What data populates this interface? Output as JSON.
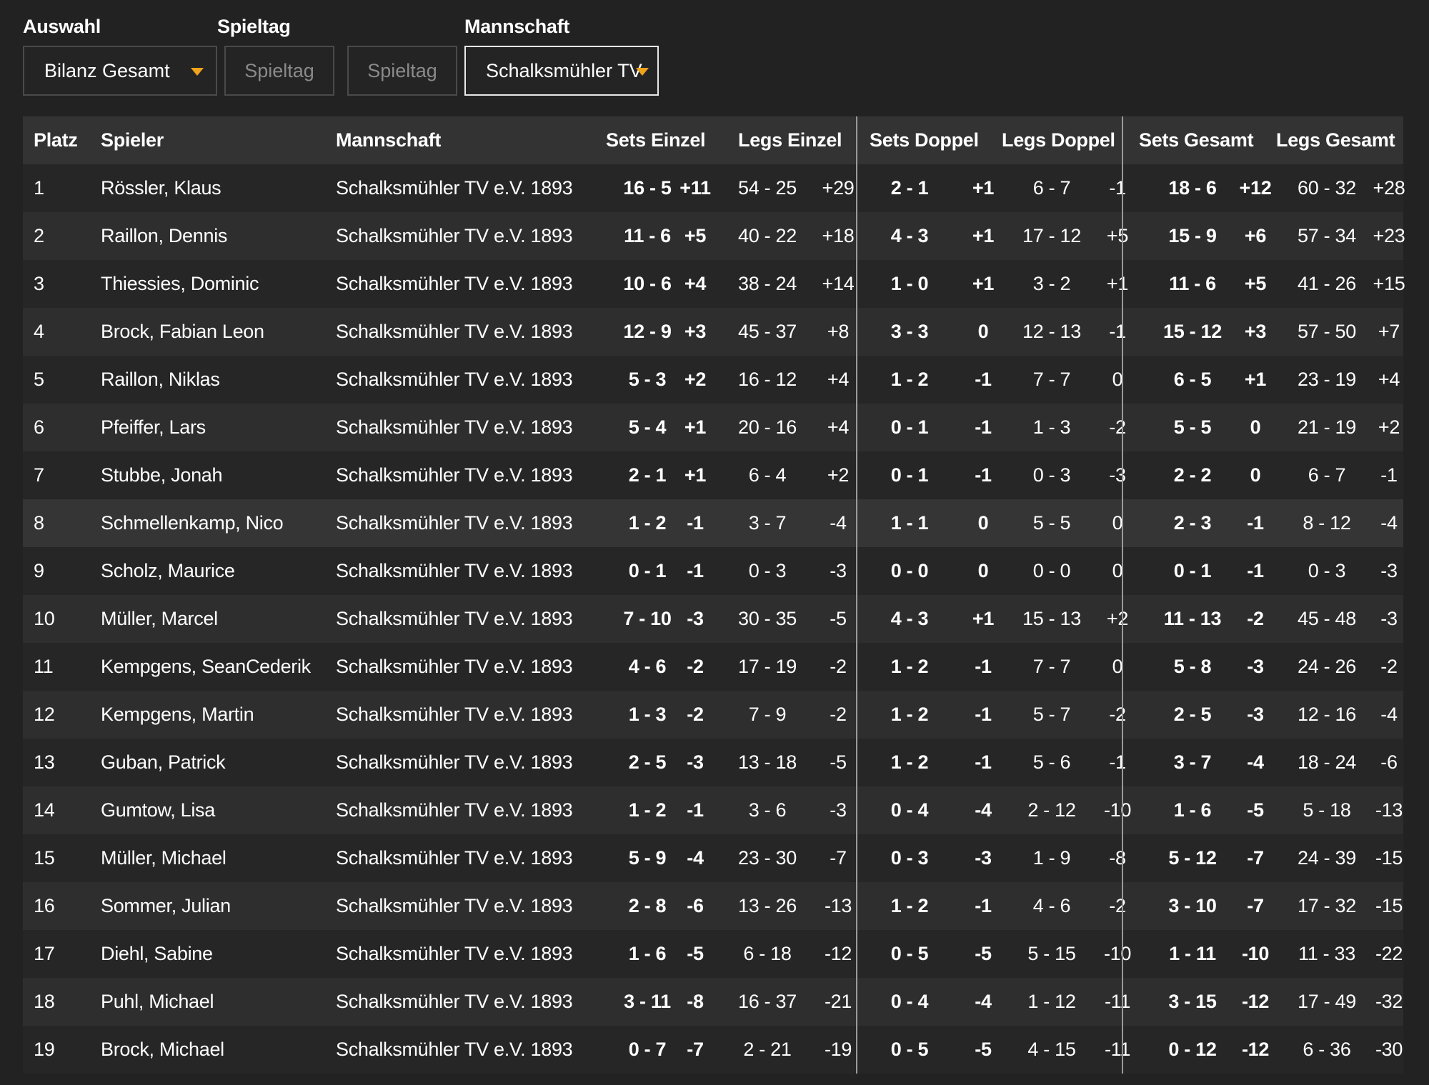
{
  "filters": {
    "selection_label": "Auswahl",
    "selection_value": "Bilanz Gesamt",
    "matchday_label": "Spieltag",
    "matchday_from_placeholder": "Spieltag",
    "matchday_to_placeholder": "Spieltag",
    "team_label": "Mannschaft",
    "team_value": "Schalksmühler TV",
    "caret_color": "#f0a41b"
  },
  "table": {
    "headers": {
      "platz": "Platz",
      "spieler": "Spieler",
      "mannschaft": "Mannschaft",
      "sets_einzel": "Sets Einzel",
      "legs_einzel": "Legs Einzel",
      "sets_doppel": "Sets Doppel",
      "legs_doppel": "Legs Doppel",
      "sets_gesamt": "Sets Gesamt",
      "legs_gesamt": "Legs Gesamt"
    },
    "rows": [
      {
        "platz": "1",
        "spieler": "Rössler, Klaus",
        "mannschaft": "Schalksmühler TV e.V. 1893",
        "se": "16 - 5",
        "sed": "+11",
        "le": "54 - 25",
        "led": "+29",
        "sd": "2 - 1",
        "sdd": "+1",
        "ld": "6 - 7",
        "ldd": "-1",
        "sg": "18 - 6",
        "sgd": "+12",
        "lg": "60 - 32",
        "lgd": "+28"
      },
      {
        "platz": "2",
        "spieler": "Raillon, Dennis",
        "mannschaft": "Schalksmühler TV e.V. 1893",
        "se": "11 - 6",
        "sed": "+5",
        "le": "40 - 22",
        "led": "+18",
        "sd": "4 - 3",
        "sdd": "+1",
        "ld": "17 - 12",
        "ldd": "+5",
        "sg": "15 - 9",
        "sgd": "+6",
        "lg": "57 - 34",
        "lgd": "+23"
      },
      {
        "platz": "3",
        "spieler": "Thiessies, Dominic",
        "mannschaft": "Schalksmühler TV e.V. 1893",
        "se": "10 - 6",
        "sed": "+4",
        "le": "38 - 24",
        "led": "+14",
        "sd": "1 - 0",
        "sdd": "+1",
        "ld": "3 - 2",
        "ldd": "+1",
        "sg": "11 - 6",
        "sgd": "+5",
        "lg": "41 - 26",
        "lgd": "+15"
      },
      {
        "platz": "4",
        "spieler": "Brock, Fabian Leon",
        "mannschaft": "Schalksmühler TV e.V. 1893",
        "se": "12 - 9",
        "sed": "+3",
        "le": "45 - 37",
        "led": "+8",
        "sd": "3 - 3",
        "sdd": "0",
        "ld": "12 - 13",
        "ldd": "-1",
        "sg": "15 - 12",
        "sgd": "+3",
        "lg": "57 - 50",
        "lgd": "+7"
      },
      {
        "platz": "5",
        "spieler": "Raillon, Niklas",
        "mannschaft": "Schalksmühler TV e.V. 1893",
        "se": "5 - 3",
        "sed": "+2",
        "le": "16 - 12",
        "led": "+4",
        "sd": "1 - 2",
        "sdd": "-1",
        "ld": "7 - 7",
        "ldd": "0",
        "sg": "6 - 5",
        "sgd": "+1",
        "lg": "23 - 19",
        "lgd": "+4"
      },
      {
        "platz": "6",
        "spieler": "Pfeiffer, Lars",
        "mannschaft": "Schalksmühler TV e.V. 1893",
        "se": "5 - 4",
        "sed": "+1",
        "le": "20 - 16",
        "led": "+4",
        "sd": "0 - 1",
        "sdd": "-1",
        "ld": "1 - 3",
        "ldd": "-2",
        "sg": "5 - 5",
        "sgd": "0",
        "lg": "21 - 19",
        "lgd": "+2"
      },
      {
        "platz": "7",
        "spieler": "Stubbe, Jonah",
        "mannschaft": "Schalksmühler TV e.V. 1893",
        "se": "2 - 1",
        "sed": "+1",
        "le": "6 - 4",
        "led": "+2",
        "sd": "0 - 1",
        "sdd": "-1",
        "ld": "0 - 3",
        "ldd": "-3",
        "sg": "2 - 2",
        "sgd": "0",
        "lg": "6 - 7",
        "lgd": "-1"
      },
      {
        "platz": "8",
        "spieler": "Schmellenkamp, Nico",
        "mannschaft": "Schalksmühler TV e.V. 1893",
        "se": "1 - 2",
        "sed": "-1",
        "le": "3 - 7",
        "led": "-4",
        "sd": "1 - 1",
        "sdd": "0",
        "ld": "5 - 5",
        "ldd": "0",
        "sg": "2 - 3",
        "sgd": "-1",
        "lg": "8 - 12",
        "lgd": "-4"
      },
      {
        "platz": "9",
        "spieler": "Scholz, Maurice",
        "mannschaft": "Schalksmühler TV e.V. 1893",
        "se": "0 - 1",
        "sed": "-1",
        "le": "0 - 3",
        "led": "-3",
        "sd": "0 - 0",
        "sdd": "0",
        "ld": "0 - 0",
        "ldd": "0",
        "sg": "0 - 1",
        "sgd": "-1",
        "lg": "0 - 3",
        "lgd": "-3"
      },
      {
        "platz": "10",
        "spieler": "Müller, Marcel",
        "mannschaft": "Schalksmühler TV e.V. 1893",
        "se": "7 - 10",
        "sed": "-3",
        "le": "30 - 35",
        "led": "-5",
        "sd": "4 - 3",
        "sdd": "+1",
        "ld": "15 - 13",
        "ldd": "+2",
        "sg": "11 - 13",
        "sgd": "-2",
        "lg": "45 - 48",
        "lgd": "-3"
      },
      {
        "platz": "11",
        "spieler": "Kempgens, SeanCederik",
        "mannschaft": "Schalksmühler TV e.V. 1893",
        "se": "4 - 6",
        "sed": "-2",
        "le": "17 - 19",
        "led": "-2",
        "sd": "1 - 2",
        "sdd": "-1",
        "ld": "7 - 7",
        "ldd": "0",
        "sg": "5 - 8",
        "sgd": "-3",
        "lg": "24 - 26",
        "lgd": "-2"
      },
      {
        "platz": "12",
        "spieler": "Kempgens, Martin",
        "mannschaft": "Schalksmühler TV e.V. 1893",
        "se": "1 - 3",
        "sed": "-2",
        "le": "7 - 9",
        "led": "-2",
        "sd": "1 - 2",
        "sdd": "-1",
        "ld": "5 - 7",
        "ldd": "-2",
        "sg": "2 - 5",
        "sgd": "-3",
        "lg": "12 - 16",
        "lgd": "-4"
      },
      {
        "platz": "13",
        "spieler": "Guban, Patrick",
        "mannschaft": "Schalksmühler TV e.V. 1893",
        "se": "2 - 5",
        "sed": "-3",
        "le": "13 - 18",
        "led": "-5",
        "sd": "1 - 2",
        "sdd": "-1",
        "ld": "5 - 6",
        "ldd": "-1",
        "sg": "3 - 7",
        "sgd": "-4",
        "lg": "18 - 24",
        "lgd": "-6"
      },
      {
        "platz": "14",
        "spieler": "Gumtow, Lisa",
        "mannschaft": "Schalksmühler TV e.V. 1893",
        "se": "1 - 2",
        "sed": "-1",
        "le": "3 - 6",
        "led": "-3",
        "sd": "0 - 4",
        "sdd": "-4",
        "ld": "2 - 12",
        "ldd": "-10",
        "sg": "1 - 6",
        "sgd": "-5",
        "lg": "5 - 18",
        "lgd": "-13"
      },
      {
        "platz": "15",
        "spieler": "Müller, Michael",
        "mannschaft": "Schalksmühler TV e.V. 1893",
        "se": "5 - 9",
        "sed": "-4",
        "le": "23 - 30",
        "led": "-7",
        "sd": "0 - 3",
        "sdd": "-3",
        "ld": "1 - 9",
        "ldd": "-8",
        "sg": "5 - 12",
        "sgd": "-7",
        "lg": "24 - 39",
        "lgd": "-15"
      },
      {
        "platz": "16",
        "spieler": "Sommer, Julian",
        "mannschaft": "Schalksmühler TV e.V. 1893",
        "se": "2 - 8",
        "sed": "-6",
        "le": "13 - 26",
        "led": "-13",
        "sd": "1 - 2",
        "sdd": "-1",
        "ld": "4 - 6",
        "ldd": "-2",
        "sg": "3 - 10",
        "sgd": "-7",
        "lg": "17 - 32",
        "lgd": "-15"
      },
      {
        "platz": "17",
        "spieler": "Diehl, Sabine",
        "mannschaft": "Schalksmühler TV e.V. 1893",
        "se": "1 - 6",
        "sed": "-5",
        "le": "6 - 18",
        "led": "-12",
        "sd": "0 - 5",
        "sdd": "-5",
        "ld": "5 - 15",
        "ldd": "-10",
        "sg": "1 - 11",
        "sgd": "-10",
        "lg": "11 - 33",
        "lgd": "-22"
      },
      {
        "platz": "18",
        "spieler": "Puhl, Michael",
        "mannschaft": "Schalksmühler TV e.V. 1893",
        "se": "3 - 11",
        "sed": "-8",
        "le": "16 - 37",
        "led": "-21",
        "sd": "0 - 4",
        "sdd": "-4",
        "ld": "1 - 12",
        "ldd": "-11",
        "sg": "3 - 15",
        "sgd": "-12",
        "lg": "17 - 49",
        "lgd": "-32"
      },
      {
        "platz": "19",
        "spieler": "Brock, Michael",
        "mannschaft": "Schalksmühler TV e.V. 1893",
        "se": "0 - 7",
        "sed": "-7",
        "le": "2 - 21",
        "led": "-19",
        "sd": "0 - 5",
        "sdd": "-5",
        "ld": "4 - 15",
        "ldd": "-11",
        "sg": "0 - 12",
        "sgd": "-12",
        "lg": "6 - 36",
        "lgd": "-30"
      }
    ]
  }
}
